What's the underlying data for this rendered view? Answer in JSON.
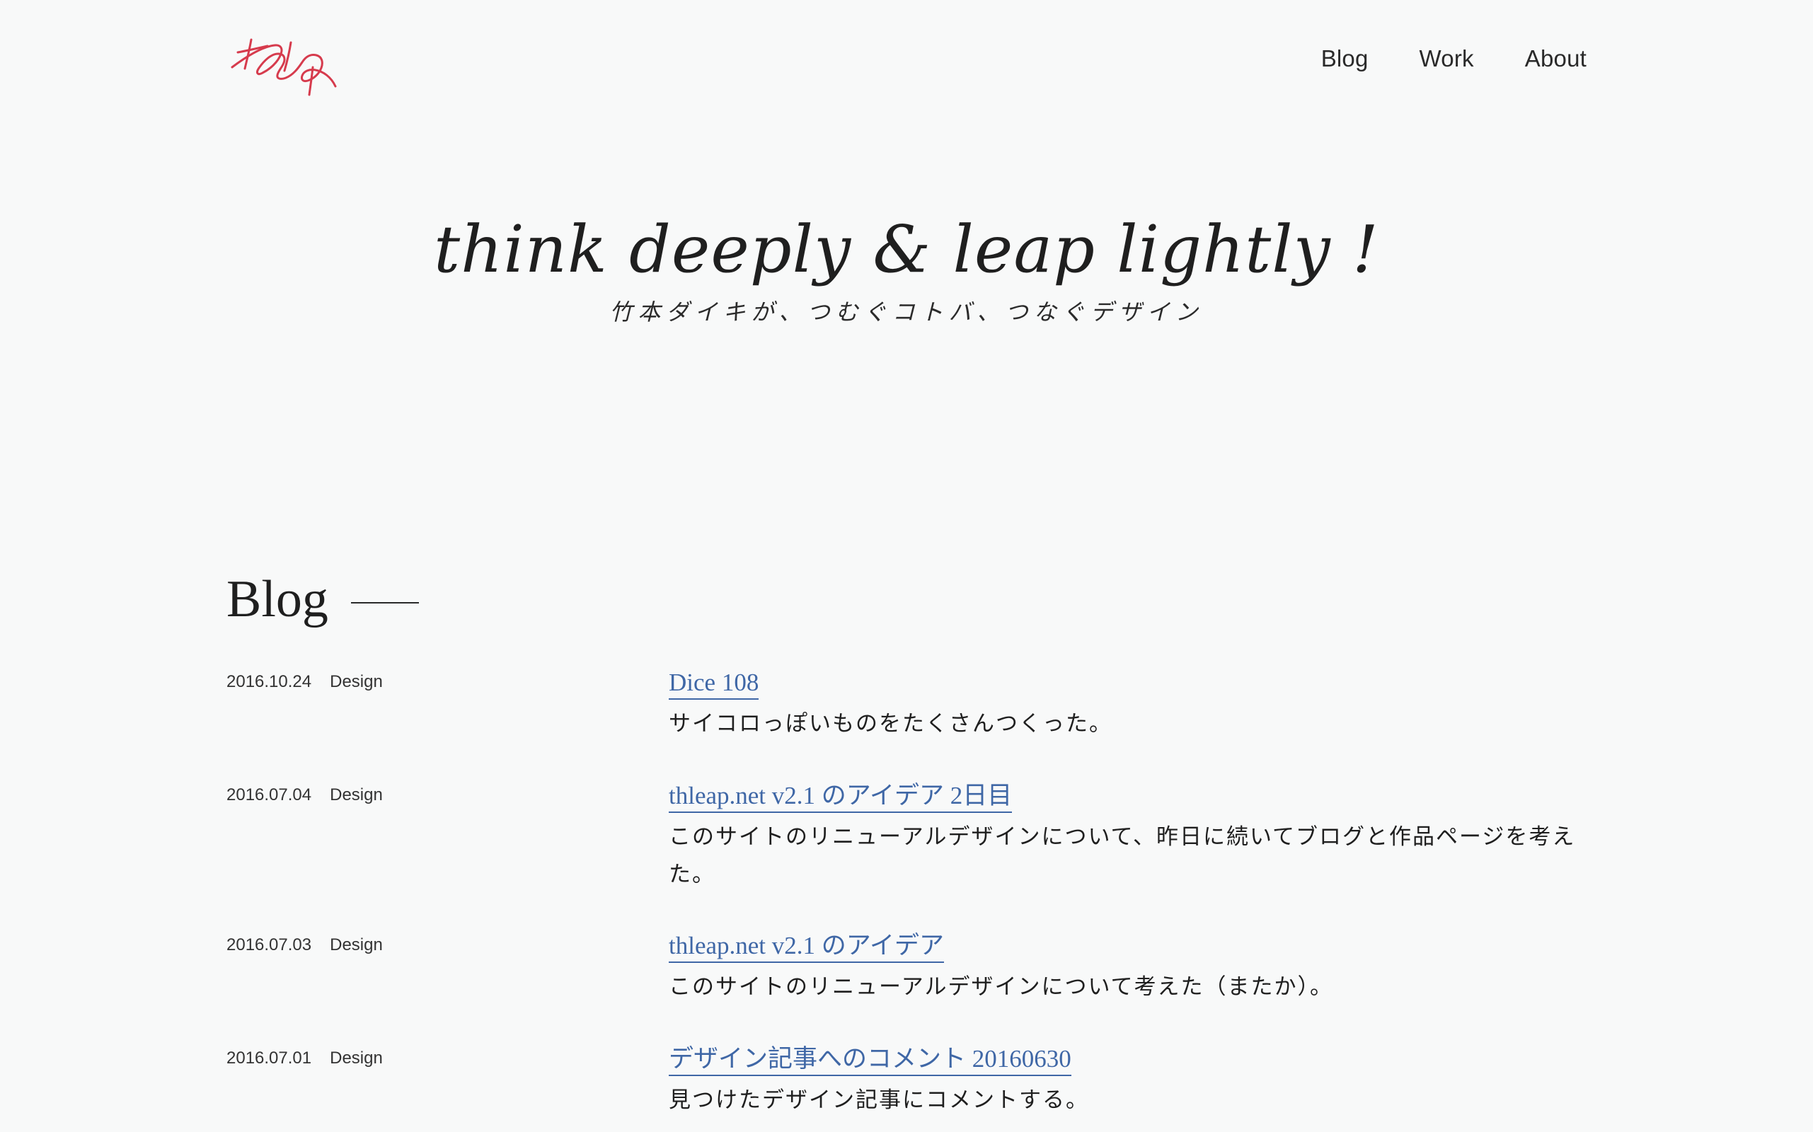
{
  "brand": {
    "logo_text": "thleap",
    "logo_color": "#d63b4d"
  },
  "nav": {
    "items": [
      {
        "label": "Blog"
      },
      {
        "label": "Work"
      },
      {
        "label": "About"
      }
    ]
  },
  "hero": {
    "title": "think deeply & leap lightly !",
    "subtitle": "竹本ダイキが、つむぐコトバ、つなぐデザイン"
  },
  "blog": {
    "heading": "Blog",
    "posts": [
      {
        "date": "2016.10.24",
        "category": "Design",
        "title": "Dice 108",
        "excerpt": "サイコロっぽいものをたくさんつくった。"
      },
      {
        "date": "2016.07.04",
        "category": "Design",
        "title": "thleap.net v2.1 のアイデア 2日目",
        "excerpt": "このサイトのリニューアルデザインについて、昨日に続いてブログと作品ページを考えた。"
      },
      {
        "date": "2016.07.03",
        "category": "Design",
        "title": "thleap.net v2.1 のアイデア",
        "excerpt": "このサイトのリニューアルデザインについて考えた（またか）。"
      },
      {
        "date": "2016.07.01",
        "category": "Design",
        "title": "デザイン記事へのコメント 20160630",
        "excerpt": "見つけたデザイン記事にコメントする。"
      }
    ]
  },
  "colors": {
    "background": "#f8f9f9",
    "link": "#3f67a6",
    "text": "#1f1f1f"
  }
}
